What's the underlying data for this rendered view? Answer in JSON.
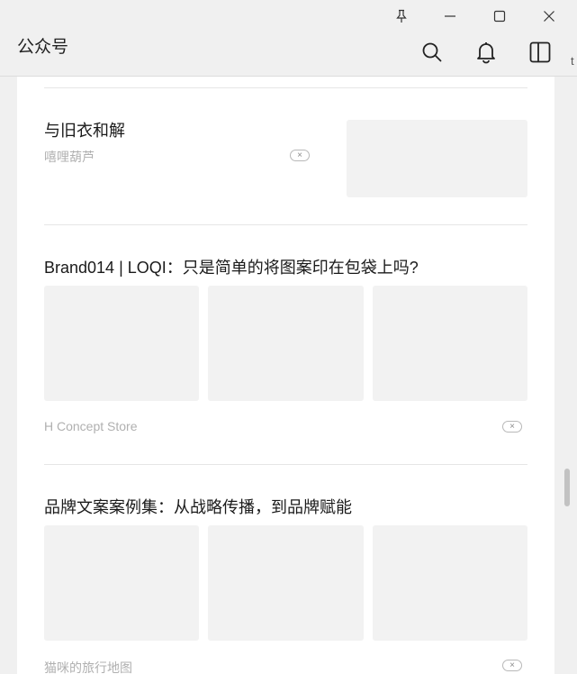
{
  "window": {
    "title": "公众号",
    "icons": [
      "pin-icon",
      "minimize-icon",
      "maximize-icon",
      "close-icon",
      "search-icon",
      "bell-icon",
      "sidebar-toggle-icon"
    ]
  },
  "articles": [
    {
      "title": "与旧衣和解",
      "source": "嘻哩葫芦",
      "dismiss_label": "×"
    },
    {
      "title": "Brand014 | LOQI：只是简单的将图案印在包袋上吗?",
      "source": "H Concept Store",
      "dismiss_label": "×"
    },
    {
      "title": "品牌文案案例集：从战略传播，到品牌赋能",
      "source": "猫咪的旅行地图",
      "dismiss_label": "×"
    }
  ],
  "scrollbar": {
    "position_fraction": 0.7
  }
}
